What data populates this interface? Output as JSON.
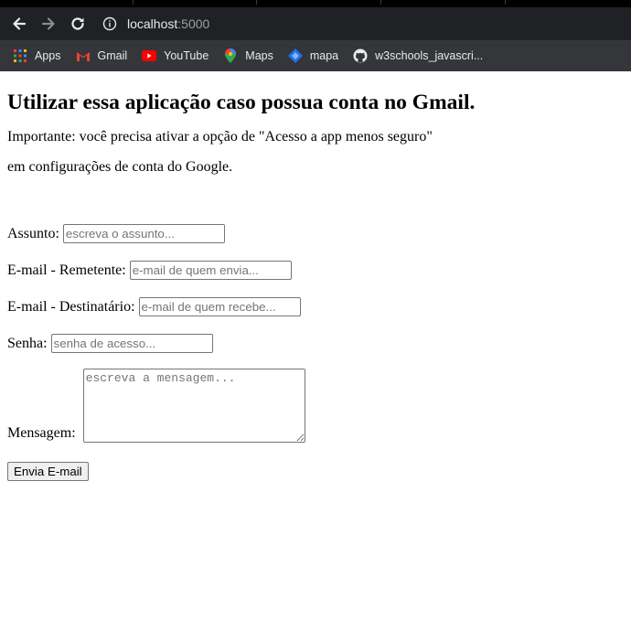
{
  "browser": {
    "url_host": "localhost",
    "url_port": ":5000",
    "bookmarks": [
      {
        "label": "Apps",
        "icon": "apps-grid-icon"
      },
      {
        "label": "Gmail",
        "icon": "gmail-icon"
      },
      {
        "label": "YouTube",
        "icon": "youtube-icon"
      },
      {
        "label": "Maps",
        "icon": "maps-pin-icon"
      },
      {
        "label": "mapa",
        "icon": "mapa-icon"
      },
      {
        "label": "w3schools_javascri...",
        "icon": "github-icon"
      }
    ]
  },
  "page": {
    "heading": "Utilizar essa aplicação caso possua conta no Gmail.",
    "note_line1": "Importante: você precisa ativar a opção de \"Acesso a app menos seguro\"",
    "note_line2": "em configurações de conta do Google.",
    "form": {
      "subject_label": "Assunto:",
      "subject_placeholder": "escreva o assunto...",
      "sender_label": "E-mail - Remetente:",
      "sender_placeholder": "e-mail de quem envia...",
      "recipient_label": "E-mail - Destinatário:",
      "recipient_placeholder": "e-mail de quem recebe...",
      "password_label": "Senha:",
      "password_placeholder": "senha de acesso...",
      "message_label": "Mensagem:",
      "message_placeholder": "escreva a mensagem...",
      "submit_label": "Envia E-mail"
    }
  },
  "colors": {
    "toolbar_bg": "#202124",
    "bookmarks_bg": "#35363a",
    "youtube_red": "#ff0000",
    "mapa_blue": "#1a73e8"
  }
}
